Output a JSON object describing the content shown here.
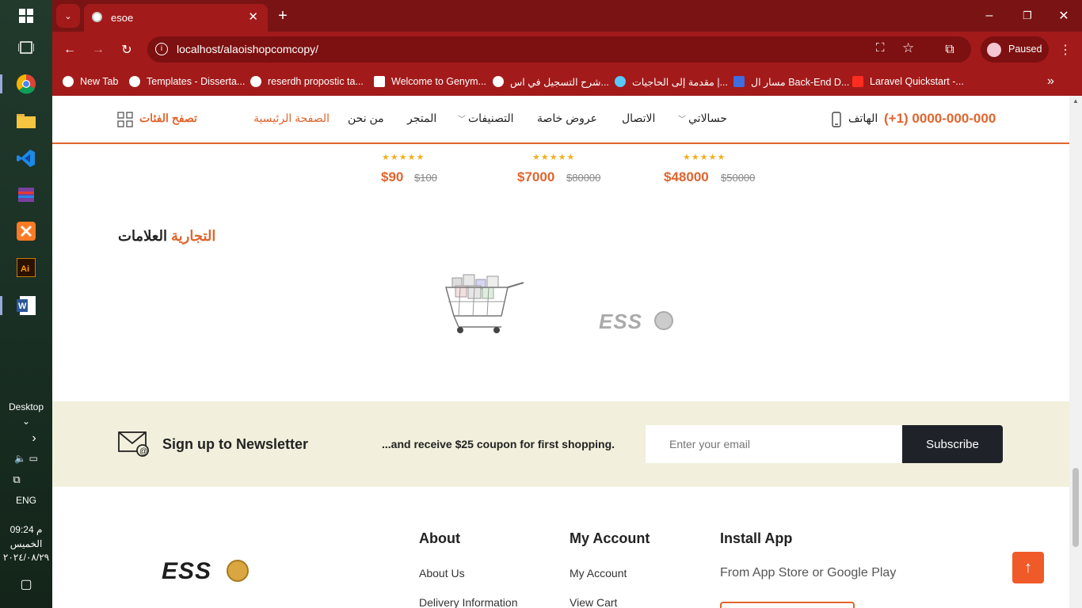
{
  "taskbar": {
    "desktop_label": "Desktop",
    "language": "ENG",
    "time": "09:24 م",
    "day": "الخميس",
    "date": "٢٠٢٤/٠٨/٢٩"
  },
  "browser": {
    "tab_title": "esoe",
    "url": "localhost/alaoishopcomcopy/",
    "profile_status": "Paused",
    "bookmarks": [
      "New Tab",
      "Templates - Disserta...",
      "reserdh propostic ta...",
      "Welcome to Genym...",
      "شرح التسجيل في اس...",
      "مقدمة إلى الحاجيات |...",
      "مسار ال Back-End D...",
      "Laravel Quickstart -..."
    ]
  },
  "site_nav": {
    "browse_categories": "تصفح الفئات",
    "home": "الصفحة الرئيسية",
    "about": "من نحن",
    "shop": "المتجر",
    "categories": "التصنيفات",
    "special_offers": "عروض خاصة",
    "contact": "الاتصال",
    "my_account": "حسالاتي",
    "phone_label": "الهاتف",
    "phone_number": "(+1) 0000-000-000"
  },
  "products": [
    {
      "price": "$90",
      "old_price": "$100",
      "rating": "★★★★★"
    },
    {
      "price": "$7000",
      "old_price": "$80000",
      "rating": "★★★★★"
    },
    {
      "price": "$48000",
      "old_price": "$50000",
      "rating": "★★★★★"
    }
  ],
  "brands": {
    "title_part1": "العلامات",
    "title_part2": "التجارية",
    "logo_text": "ESS"
  },
  "newsletter": {
    "title": "Sign up to Newsletter",
    "subtitle": "...and receive $25 coupon for first shopping.",
    "placeholder": "Enter your email",
    "button": "Subscribe"
  },
  "footer": {
    "logo_text": "ESS",
    "about_heading": "About",
    "about_links": [
      "About Us",
      "Delivery Information"
    ],
    "account_heading": "My Account",
    "account_links": [
      "My Account",
      "View Cart"
    ],
    "app_heading": "Install App",
    "app_text": "From App Store or Google Play"
  },
  "colors": {
    "accent": "#e0652e",
    "browser_frame": "#a31a1a",
    "newsletter_bg": "#f2f0dc"
  }
}
